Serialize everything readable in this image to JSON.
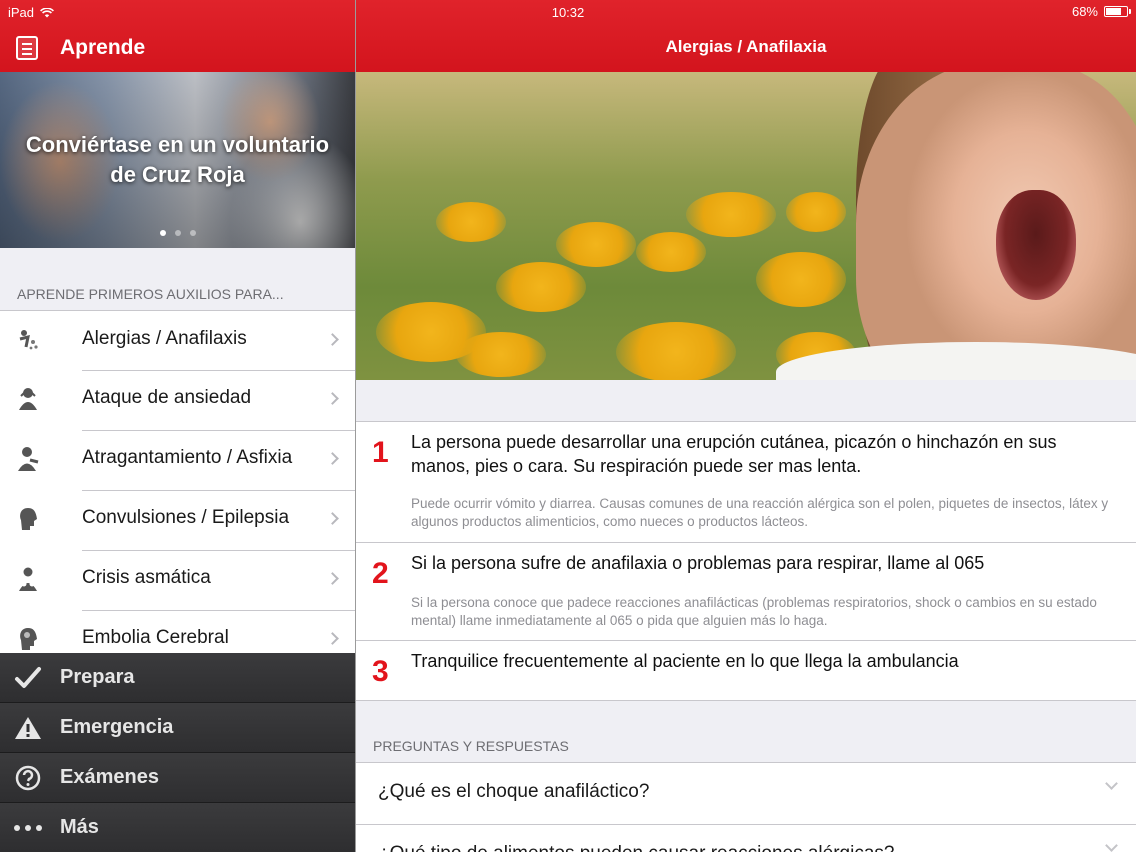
{
  "status_bar": {
    "carrier": "iPad",
    "time": "10:32",
    "battery": "68%",
    "battery_level": 0.68
  },
  "left_header": {
    "title": "Aprende"
  },
  "right_header": {
    "title": "Alergias / Anafilaxia"
  },
  "banner": {
    "text_line1": "Conviértase en un voluntario",
    "text_line2": "de Cruz Roja",
    "page_count": 3,
    "active_page": 1
  },
  "section": {
    "title": "APRENDE PRIMEROS AUXILIOS PARA..."
  },
  "menu": {
    "items": [
      {
        "label": "Alergias / Anafilaxis",
        "icon": "allergy-icon"
      },
      {
        "label": "Ataque de ansiedad",
        "icon": "anxiety-icon"
      },
      {
        "label": "Atragantamiento / Asfixia",
        "icon": "choking-icon"
      },
      {
        "label": "Convulsiones / Epilepsia",
        "icon": "seizure-icon"
      },
      {
        "label": "Crisis asmática",
        "icon": "asthma-icon"
      },
      {
        "label": "Embolia Cerebral",
        "icon": "stroke-icon"
      }
    ]
  },
  "tabs": [
    {
      "label": "Prepara",
      "icon": "checkmark-icon"
    },
    {
      "label": "Emergencia",
      "icon": "warning-icon"
    },
    {
      "label": "Exámenes",
      "icon": "question-icon"
    },
    {
      "label": "Más",
      "icon": "more-icon"
    }
  ],
  "steps": [
    {
      "number": "1",
      "main": "La persona puede desarrollar una erupción cutánea, picazón o hinchazón en sus manos, pies o cara. Su respiración puede ser mas lenta.",
      "sub": "Puede ocurrir vómito y diarrea. Causas comunes de una reacción alérgica son el polen, piquetes de insectos, látex y algunos productos alimenticios, como nueces o productos lácteos."
    },
    {
      "number": "2",
      "main": "Si la persona sufre de anafilaxia o problemas para respirar, llame al 065",
      "sub": "Si la persona conoce que padece reacciones anafilácticas (problemas respiratorios, shock o cambios en su estado mental) llame inmediatamente al 065 o pida que alguien más lo haga."
    },
    {
      "number": "3",
      "main": "Tranquilice frecuentemente al paciente en lo que llega la ambulancia",
      "sub": ""
    }
  ],
  "qa": {
    "title": "PREGUNTAS Y RESPUESTAS",
    "items": [
      {
        "question": "¿Qué es el choque anafiláctico?"
      },
      {
        "question": "¿Qué tipo de alimentos pueden causar reacciones alérgicas?"
      }
    ]
  },
  "colors": {
    "brand_red": "#d3141d",
    "step_number": "#e2141c",
    "tabbar": "#2f2f31"
  }
}
